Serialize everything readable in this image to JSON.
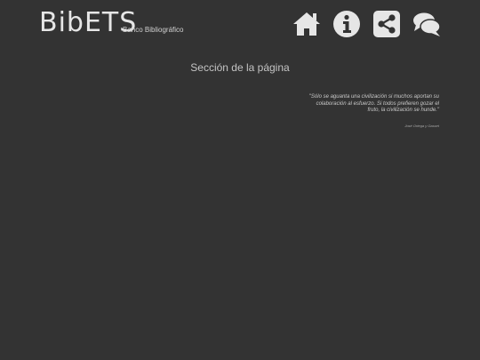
{
  "header": {
    "logo_text": "BibETS",
    "logo_subtitle": "Banco Bibliográfico"
  },
  "nav": [
    {
      "icon": "home-icon"
    },
    {
      "icon": "info-icon"
    },
    {
      "icon": "share-icon"
    },
    {
      "icon": "chat-icon"
    }
  ],
  "main": {
    "section_title": "Sección de la página",
    "quote_text": "\"Sólo se aguanta una civilización si muchos aportan su colaboración al esfuerzo. Si todos prefieren gozar el fruto, la civilización se hunde.\"",
    "quote_author": "José Ortega y Gasset"
  },
  "colors": {
    "background": "#333333",
    "icon_fill": "#e6e6e6",
    "text": "#c8c8c8"
  }
}
